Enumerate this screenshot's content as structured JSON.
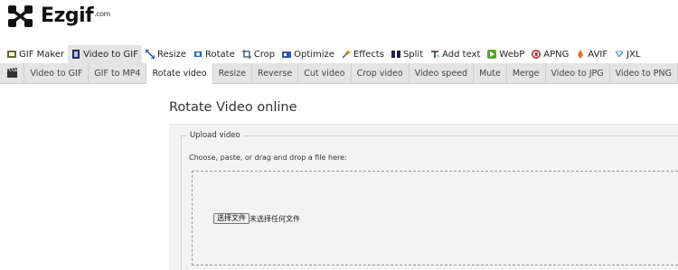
{
  "logo": {
    "name": "Ezgif",
    "suffix": ".com"
  },
  "main_nav": [
    {
      "label": "GIF Maker",
      "icon": "gif-maker-icon",
      "color": "#6a6a2a"
    },
    {
      "label": "Video to GIF",
      "icon": "video-icon",
      "color": "#2a2a6a",
      "active": true
    },
    {
      "label": "Resize",
      "icon": "resize-icon",
      "color": "#2244aa"
    },
    {
      "label": "Rotate",
      "icon": "rotate-icon",
      "color": "#2266bb"
    },
    {
      "label": "Crop",
      "icon": "crop-icon",
      "color": "#556677"
    },
    {
      "label": "Optimize",
      "icon": "optimize-icon",
      "color": "#3355aa"
    },
    {
      "label": "Effects",
      "icon": "effects-icon",
      "color": "#dd8800"
    },
    {
      "label": "Split",
      "icon": "split-icon",
      "color": "#222244"
    },
    {
      "label": "Add text",
      "icon": "add-text-icon",
      "color": "#333333"
    },
    {
      "label": "WebP",
      "icon": "webp-icon",
      "color": "#55aa22"
    },
    {
      "label": "APNG",
      "icon": "apng-icon",
      "color": "#cc2222"
    },
    {
      "label": "AVIF",
      "icon": "avif-icon",
      "color": "#ee6622"
    },
    {
      "label": "JXL",
      "icon": "jxl-icon",
      "color": "#5599cc"
    }
  ],
  "sub_nav": [
    {
      "label": "Video to GIF"
    },
    {
      "label": "GIF to MP4"
    },
    {
      "label": "Rotate video",
      "active": true
    },
    {
      "label": "Resize"
    },
    {
      "label": "Reverse"
    },
    {
      "label": "Cut video"
    },
    {
      "label": "Crop video"
    },
    {
      "label": "Video speed"
    },
    {
      "label": "Mute"
    },
    {
      "label": "Merge"
    },
    {
      "label": "Video to JPG"
    },
    {
      "label": "Video to PNG"
    }
  ],
  "page": {
    "title": "Rotate Video online",
    "legend": "Upload video",
    "instructions": "Choose, paste, or drag and drop a file here:",
    "file_button": "选择文件",
    "file_status": "未选择任何文件"
  }
}
